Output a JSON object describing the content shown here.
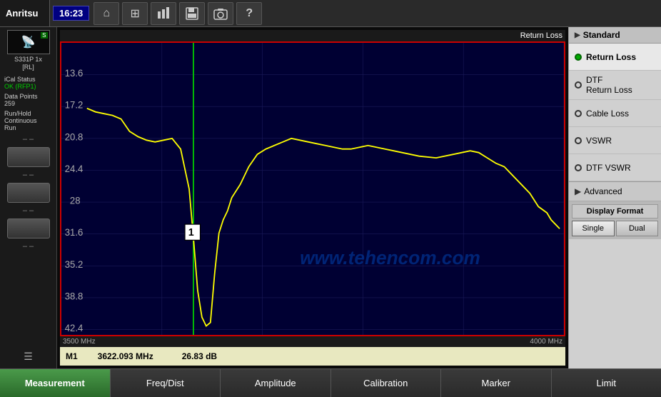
{
  "app": {
    "logo": "Anritsu",
    "time": "16:23"
  },
  "top_icons": [
    {
      "name": "home-icon",
      "symbol": "⌂"
    },
    {
      "name": "grid-icon",
      "symbol": "⊞"
    },
    {
      "name": "signal-icon",
      "symbol": "◈"
    },
    {
      "name": "save-icon",
      "symbol": "💾"
    },
    {
      "name": "camera-icon",
      "symbol": "⬡"
    },
    {
      "name": "help-icon",
      "symbol": "?"
    }
  ],
  "device": {
    "label": "S331P 1x\n[RL]"
  },
  "status": {
    "ical_label": "iCal Status",
    "ical_value": "OK (RFP1)",
    "data_points_label": "Data Points",
    "data_points_value": "259",
    "run_hold_label": "Run/Hold",
    "run_hold_value": "Continuous\nRun"
  },
  "chart": {
    "title": "Return Loss",
    "freq_start": "3500 MHz",
    "freq_end": "4000 MHz",
    "y_labels": [
      "13.6",
      "17.2",
      "20.8",
      "24.4",
      "28",
      "31.6",
      "35.2",
      "38.8",
      "42.4"
    ],
    "marker1": "M1",
    "marker1_freq": "3622.093 MHz",
    "marker1_value": "26.83 dB",
    "watermark": "www.tehencom.com"
  },
  "right_sidebar": {
    "header": "Standard",
    "items": [
      {
        "label": "Return Loss",
        "active": true
      },
      {
        "label": "DTF\nReturn Loss",
        "active": false
      },
      {
        "label": "Cable Loss",
        "active": false
      },
      {
        "label": "VSWR",
        "active": false
      },
      {
        "label": "DTF VSWR",
        "active": false
      }
    ],
    "advanced_label": "Advanced",
    "display_format_label": "Display Format",
    "format_options": [
      "Single",
      "Dual"
    ]
  },
  "bottom_tabs": [
    {
      "label": "Measurement",
      "active": true
    },
    {
      "label": "Freq/Dist",
      "active": false
    },
    {
      "label": "Amplitude",
      "active": false
    },
    {
      "label": "Calibration",
      "active": false
    },
    {
      "label": "Marker",
      "active": false
    },
    {
      "label": "Limit",
      "active": false
    }
  ]
}
